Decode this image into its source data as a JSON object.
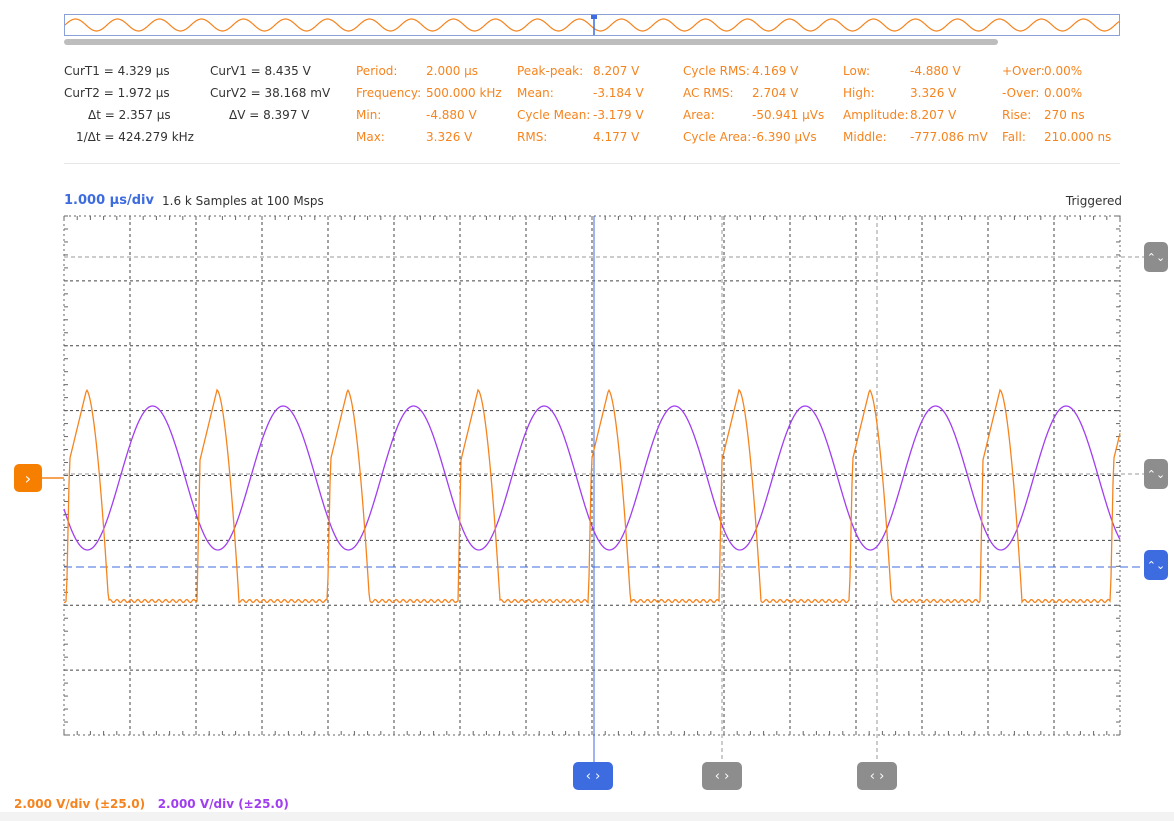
{
  "cursors": {
    "curT1": "CurT1 = 4.329 µs",
    "curT2": "CurT2 = 1.972 µs",
    "dT": "Δt = 2.357 µs",
    "invDT": "1/Δt = 424.279 kHz",
    "curV1": "CurV1 = 8.435 V",
    "curV2": "CurV2 = 38.168 mV",
    "dV": "ΔV = 8.397 V"
  },
  "measurements": {
    "col1": [
      {
        "label": "Period:",
        "value": "2.000 µs"
      },
      {
        "label": "Frequency:",
        "value": "500.000 kHz"
      },
      {
        "label": "Min:",
        "value": "-4.880 V"
      },
      {
        "label": "Max:",
        "value": "3.326 V"
      }
    ],
    "col2": [
      {
        "label": "Peak-peak:",
        "value": "8.207 V"
      },
      {
        "label": "Mean:",
        "value": "-3.184 V"
      },
      {
        "label": "Cycle Mean:",
        "value": "-3.179 V"
      },
      {
        "label": "RMS:",
        "value": "4.177 V"
      }
    ],
    "col3": [
      {
        "label": "Cycle RMS:",
        "value": "4.169 V"
      },
      {
        "label": "AC RMS:",
        "value": "2.704 V"
      },
      {
        "label": "Area:",
        "value": "-50.941 µVs"
      },
      {
        "label": "Cycle Area:",
        "value": "-6.390 µVs"
      }
    ],
    "col4": [
      {
        "label": "Low:",
        "value": "-4.880 V"
      },
      {
        "label": "High:",
        "value": "3.326 V"
      },
      {
        "label": "Amplitude:",
        "value": "8.207 V"
      },
      {
        "label": "Middle:",
        "value": "-777.086 mV"
      }
    ],
    "col5": [
      {
        "label": "+Over:",
        "value": "0.00%"
      },
      {
        "label": "-Over:",
        "value": "0.00%"
      },
      {
        "label": "Rise:",
        "value": "270 ns"
      },
      {
        "label": "Fall:",
        "value": "210.000 ns"
      }
    ]
  },
  "status": {
    "timebase": "1.000 µs/div",
    "samples": "1.6 k Samples at 100 Msps",
    "trigger": "Triggered"
  },
  "channels": [
    {
      "scale": "2.000 V/div (±25.0)",
      "color": "#f5841f"
    },
    {
      "scale": "2.000 V/div (±25.0)",
      "color": "#a03ef0"
    }
  ],
  "colors": {
    "ch1": "#f5841f",
    "ch2": "#a03ef0",
    "cursor": "#3d6be0",
    "grid": "#333333"
  },
  "icons": {
    "scroll_updown": "⌃⌄",
    "chevron_right": "›",
    "chevron_leftright": "‹ ›"
  }
}
